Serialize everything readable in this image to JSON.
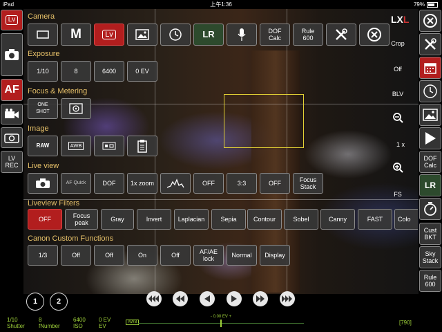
{
  "status_bar": {
    "device": "iPad",
    "time": "上午1:36",
    "battery": "79%"
  },
  "sections": {
    "camera": "Camera",
    "exposure": "Exposure",
    "focus": "Focus & Metering",
    "image": "Image",
    "liveview": "Live view",
    "filters": "Liveview Filters",
    "custom": "Canon Custom Functions"
  },
  "camera_row": {
    "manual": "M",
    "lv": "Lv",
    "lr": "LR",
    "dof": "DOF\nCalc",
    "rule": "Rule\n600"
  },
  "exposure_row": [
    "1/10",
    "8",
    "6400",
    "0 EV"
  ],
  "focus_row": {
    "oneshot": "ONE\nSHOT"
  },
  "image_row": {
    "raw": "RAW",
    "awb": "AWB"
  },
  "liveview_row": {
    "afquick": "AF Quick",
    "dof": "DOF",
    "zoom": "1x zoom",
    "off1": "OFF",
    "ratio": "3:3",
    "off2": "OFF",
    "focus_stack": "Focus\nStack"
  },
  "filters_row": [
    "OFF",
    "Focus\npeak",
    "Gray",
    "Invert",
    "Laplacian",
    "Sepia",
    "Contour",
    "Sobel",
    "Canny",
    "FAST",
    "Colo"
  ],
  "custom_row": [
    "1/3",
    "Off",
    "Off",
    "On",
    "Off",
    "AF/AE\nlock",
    "Normal",
    "Display"
  ],
  "left_bar": {
    "lv": "Lv",
    "af": "AF",
    "lvrec": "LV\nREC"
  },
  "right_overlay": {
    "crop": "Crop",
    "off": "Off",
    "blv": "BLV",
    "zoom": "1 x",
    "fs": "FS"
  },
  "right_bar": {
    "dof": "DOF\nCalc",
    "lr": "LR",
    "cust_bkt": "Cust\nBKT",
    "sky_stack": "Sky\nStack",
    "rule": "Rule\n600"
  },
  "bottom": {
    "circle1": "1",
    "circle2": "2",
    "shutter_val": "1/10",
    "shutter_lbl": "Shutter",
    "fnumber_val": "8",
    "fnumber_lbl": "fNumber",
    "iso_val": "6400",
    "iso_lbl": "ISO",
    "ev_val": "0 EV",
    "ev_lbl": "EV",
    "awb": "AWB",
    "meter": "0.00 EV",
    "meter_minus": "-",
    "meter_plus": "+",
    "shots": "[790]"
  },
  "colors": {
    "accent_red": "#b21e1e",
    "section_label": "#e8c26a",
    "info_green": "#9fd23a",
    "focus_box": "#e3d235"
  }
}
